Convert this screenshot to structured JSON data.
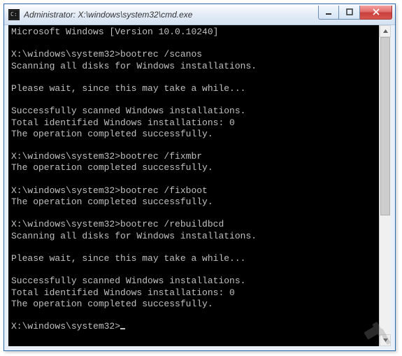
{
  "titlebar": {
    "title": "Administrator: X:\\windows\\system32\\cmd.exe",
    "icon": "cmd-icon"
  },
  "window_controls": {
    "minimize": "minimize",
    "maximize": "maximize",
    "close": "close"
  },
  "terminal": {
    "lines": [
      "Microsoft Windows [Version 10.0.10240]",
      "",
      "X:\\windows\\system32>bootrec /scanos",
      "Scanning all disks for Windows installations.",
      "",
      "Please wait, since this may take a while...",
      "",
      "Successfully scanned Windows installations.",
      "Total identified Windows installations: 0",
      "The operation completed successfully.",
      "",
      "X:\\windows\\system32>bootrec /fixmbr",
      "The operation completed successfully.",
      "",
      "X:\\windows\\system32>bootrec /fixboot",
      "The operation completed successfully.",
      "",
      "X:\\windows\\system32>bootrec /rebuildbcd",
      "Scanning all disks for Windows installations.",
      "",
      "Please wait, since this may take a while...",
      "",
      "Successfully scanned Windows installations.",
      "Total identified Windows installations: 0",
      "The operation completed successfully.",
      "",
      "X:\\windows\\system32>"
    ]
  }
}
